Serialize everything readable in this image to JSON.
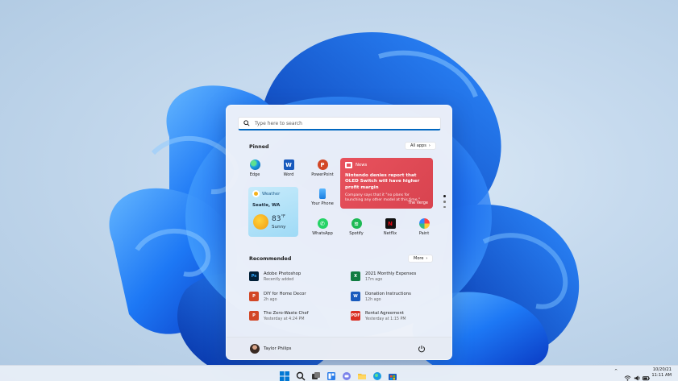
{
  "start_menu": {
    "search_placeholder": "Type here to search",
    "pinned": {
      "title": "Pinned",
      "all_apps_label": "All apps",
      "apps": [
        {
          "label": "Edge",
          "icon": "edge-icon"
        },
        {
          "label": "Word",
          "icon": "word-icon"
        },
        {
          "label": "PowerPoint",
          "icon": "powerpoint-icon"
        },
        {
          "label": "Your Phone",
          "icon": "phone-icon"
        },
        {
          "label": "WhatsApp",
          "icon": "whatsapp-icon"
        },
        {
          "label": "Spotify",
          "icon": "spotify-icon"
        },
        {
          "label": "Netflix",
          "icon": "netflix-icon"
        },
        {
          "label": "Paint",
          "icon": "paint-icon"
        }
      ]
    },
    "news_widget": {
      "title": "News",
      "headline": "Nintendo denies report that OLED Switch will have higher profit margin",
      "body": "Company says that it \"no plans for launching any other model at this time.\"",
      "source": "The Verge"
    },
    "weather_widget": {
      "title": "Weather",
      "city": "Seatle, WA",
      "temperature": "83",
      "unit": "°F",
      "condition": "Sunny"
    },
    "recommended": {
      "title": "Recommended",
      "more_label": "More",
      "items": [
        {
          "title": "Adobe Photoshop",
          "subtitle": "Recently added",
          "icon": "photoshop-icon"
        },
        {
          "title": "2021 Monthly Expenses",
          "subtitle": "17m ago",
          "icon": "excel-icon"
        },
        {
          "title": "DIY for Home Decor",
          "subtitle": "2h ago",
          "icon": "powerpoint-icon"
        },
        {
          "title": "Donation Instructions",
          "subtitle": "12h ago",
          "icon": "word-icon"
        },
        {
          "title": "The Zero-Waste Chef",
          "subtitle": "Yesterday at 4:24 PM",
          "icon": "powerpoint-icon"
        },
        {
          "title": "Rental Agreement",
          "subtitle": "Yesterday at 1:15 PM",
          "icon": "pdf-icon"
        }
      ]
    },
    "user": {
      "name": "Taylor Philips"
    }
  },
  "taskbar": {
    "date": "10/20/21",
    "time": "11:11 AM",
    "tray_chevron": "^"
  },
  "colors": {
    "accent": "#0067c0",
    "news_red": "#e04f5a",
    "weather_blue": "#b5e3f8"
  }
}
